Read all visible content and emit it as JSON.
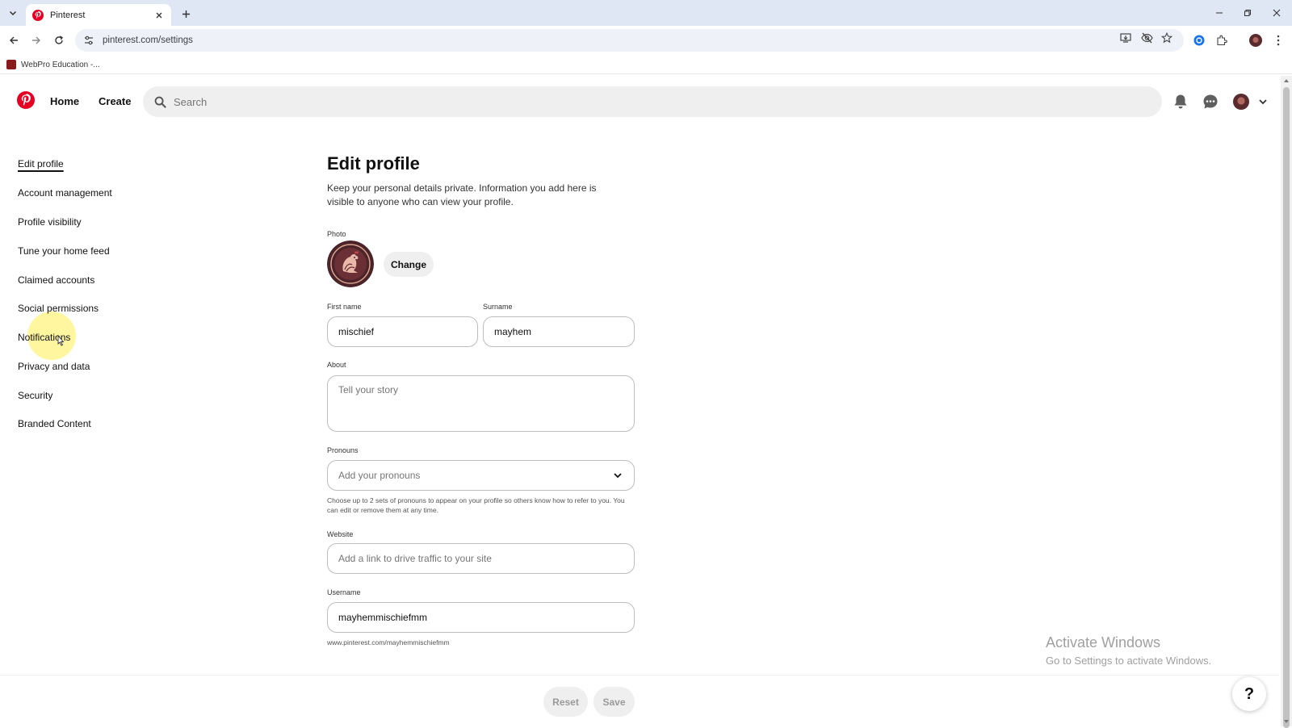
{
  "browser": {
    "tab_title": "Pinterest",
    "url": "pinterest.com/settings",
    "bookmark": "WebPro Education -..."
  },
  "header": {
    "nav_home": "Home",
    "nav_create": "Create",
    "search_placeholder": "Search",
    "brand_color": "#e60023"
  },
  "sidebar": {
    "items": [
      {
        "label": "Edit profile",
        "active": true
      },
      {
        "label": "Account management"
      },
      {
        "label": "Profile visibility"
      },
      {
        "label": "Tune your home feed"
      },
      {
        "label": "Claimed accounts"
      },
      {
        "label": "Social permissions"
      },
      {
        "label": "Notifications",
        "hovered": true
      },
      {
        "label": "Privacy and data"
      },
      {
        "label": "Security"
      },
      {
        "label": "Branded Content"
      }
    ]
  },
  "form": {
    "title": "Edit profile",
    "description": "Keep your personal details private. Information you add here is visible to anyone who can view your profile.",
    "photo_label": "Photo",
    "change_label": "Change",
    "first_name_label": "First name",
    "first_name_value": "mischief",
    "surname_label": "Surname",
    "surname_value": "mayhem",
    "about_label": "About",
    "about_placeholder": "Tell your story",
    "pronouns_label": "Pronouns",
    "pronouns_placeholder": "Add your pronouns",
    "pronouns_help": "Choose up to 2 sets of pronouns to appear on your profile so others know how to refer to you. You can edit or remove them at any time.",
    "website_label": "Website",
    "website_placeholder": "Add a link to drive traffic to your site",
    "username_label": "Username",
    "username_value": "mayhemmischiefmm",
    "profile_url": "www.pinterest.com/mayhemmischiefmm"
  },
  "footer": {
    "reset_label": "Reset",
    "save_label": "Save",
    "help_label": "?"
  },
  "watermark": {
    "line1": "Activate Windows",
    "line2": "Go to Settings to activate Windows."
  }
}
